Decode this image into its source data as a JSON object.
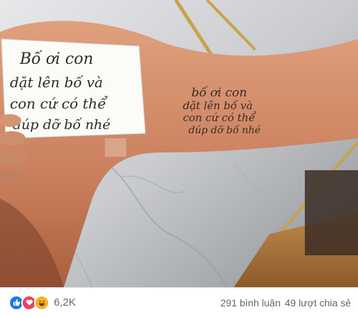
{
  "post": {
    "note_text": [
      "Bố ơi con",
      "dặt lên bố và",
      "con cứ có thể",
      "dúp dỡ bố nhé"
    ],
    "tattoo_text": [
      "bố ơi con",
      "dặt lên bố và",
      "con cứ có thể",
      "dúp dỡ bố nhé"
    ]
  },
  "footer": {
    "reaction_icons": [
      "like-icon",
      "love-icon",
      "haha-icon"
    ],
    "reaction_count": "6,2K",
    "comments": "291 bình luận",
    "shares": "49 lượt chia sẻ"
  },
  "colors": {
    "like": "#1877f2",
    "love": "#f33e58",
    "haha": "#f7b125",
    "meta_text": "#65676b"
  }
}
